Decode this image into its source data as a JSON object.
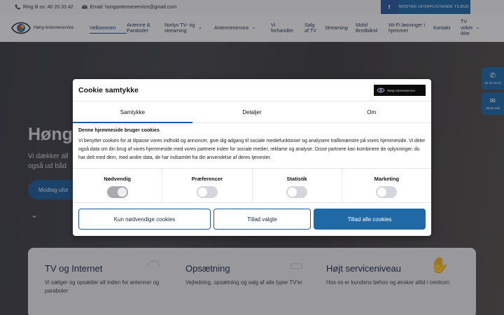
{
  "topbar": {
    "phone": "Ring til os: 40 20 33 42",
    "email": "Email: hongantenneservice@gmail.com",
    "facebook_icon": "facebook-icon",
    "offer_button": "MODTAG UFORPLIGTENDE TILBUD"
  },
  "header": {
    "logo_text": "Høng Antenneservice",
    "nav": [
      {
        "label": "Velkommen"
      },
      {
        "label": "Antenne & Paraboler"
      },
      {
        "label": "Norlys TV- og streaming"
      },
      {
        "label": "Antenneservice"
      },
      {
        "label": "Vi forhandler"
      },
      {
        "label": "Salg af TV"
      },
      {
        "label": "Streaming"
      },
      {
        "label": "Mobil Bredbånd"
      },
      {
        "label": "Wi-Fi løsninger i hjemmet"
      },
      {
        "label": "Kontakt"
      },
      {
        "label": "TV virker ikke"
      }
    ]
  },
  "hero": {
    "title": "Høng",
    "subtitle_line1": "Vi dækker all",
    "subtitle_line2": "også ud båd",
    "button": "Modtag ufor"
  },
  "side": {
    "phone": "40 20 33 42",
    "email": "Send mail"
  },
  "features": [
    {
      "title": "TV og Internet",
      "text": "Vi sælger og opsætter alt inden for antenner og paraboler",
      "icon": "wifi-icon"
    },
    {
      "title": "Opsætning",
      "text": "Vejledning, opsætning og salg af alle typer TV'er",
      "icon": "tv-icon"
    },
    {
      "title": "Højt serviceniveau",
      "text": "Hos os er kundens behov og ønsker altid i centrum",
      "icon": "handshake-icon"
    }
  ],
  "cookie": {
    "title": "Cookie samtykke",
    "logo_text": "Høng Antenneservice",
    "tabs": [
      "Samtykke",
      "Detaljer",
      "Om"
    ],
    "heading": "Denne hjemmeside bruger cookies",
    "text": "Vi benytter cookies for at tilpasse vores indhold og annoncer, give dig adgang til sociale mediefunktioner og analysere trafikmønstre på vores hjemmeside. Vi deler også data om din brug af vores hjemmeside med vores partnere inden for sociale medier, reklame og analyse. Disse partnere kan kombinere de oplysninger, du har delt med dem, med andre data, de har indsamlet fra din anvendelse af deres tjenester.",
    "toggles": [
      {
        "label": "Nødvendig",
        "state": "on-disabled"
      },
      {
        "label": "Præferencer",
        "state": "off"
      },
      {
        "label": "Statistik",
        "state": "off"
      },
      {
        "label": "Marketing",
        "state": "off"
      }
    ],
    "buttons": {
      "necessary": "Kun nødvendige cookies",
      "selected": "Tillad valgte",
      "all": "Tillad alle cookies"
    }
  }
}
